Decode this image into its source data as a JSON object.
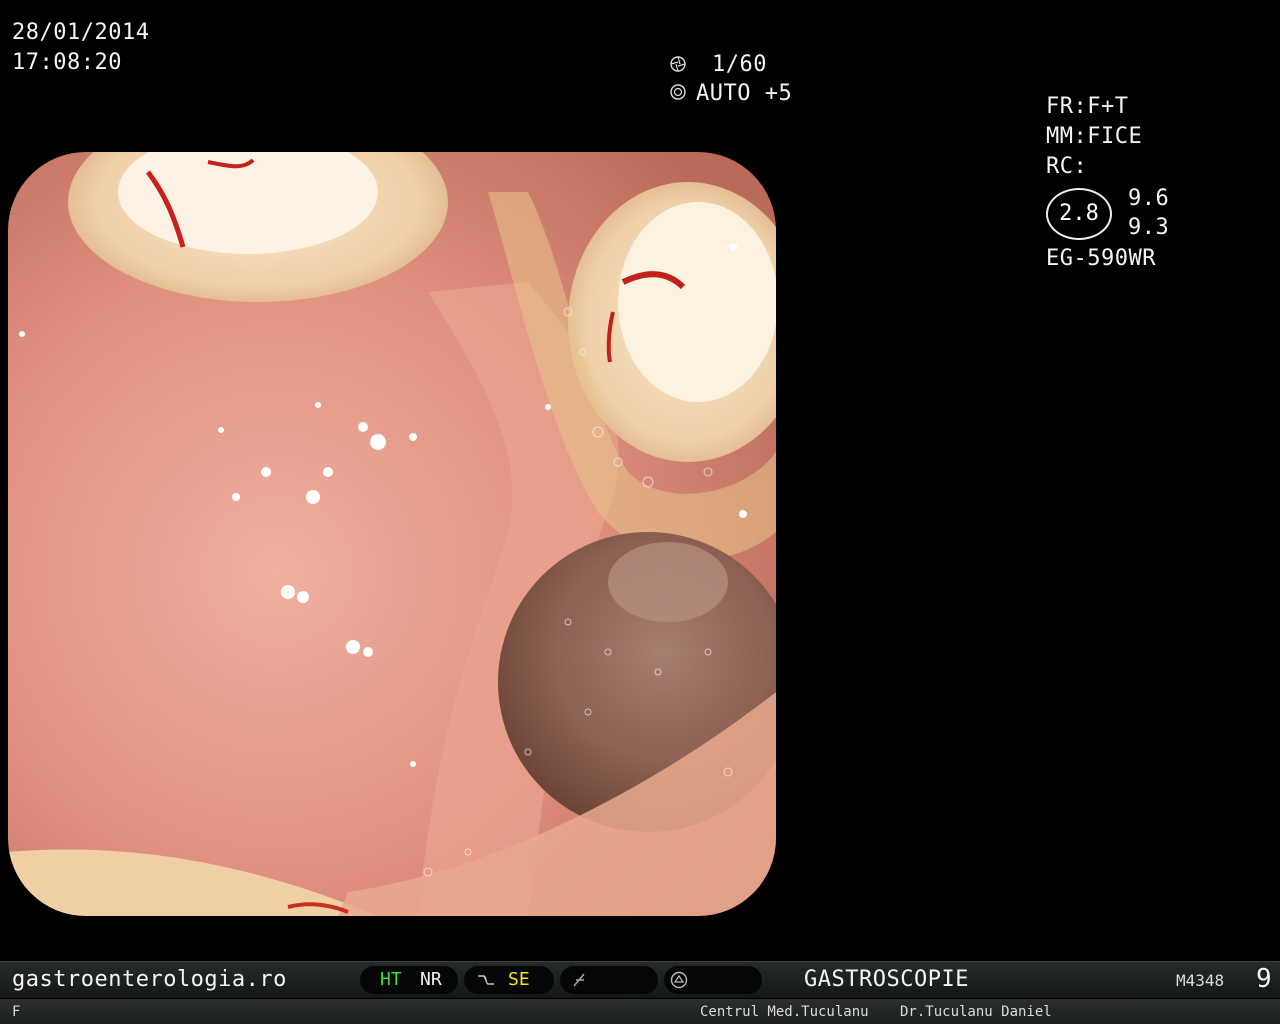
{
  "overlay": {
    "date": "28/01/2014",
    "time": "17:08:20",
    "shutter": "1/60",
    "exposure": "AUTO +5",
    "fr": "FR:F+T",
    "mm": "MM:FICE",
    "rc_label": "RC:",
    "rc_value": "2.8",
    "rc_top": "9.6",
    "rc_bottom": "9.3",
    "scope_model": "EG-590WR"
  },
  "icons": {
    "shutter": "aperture-icon",
    "exposure": "iris-icon",
    "se_mode": "wave-icon",
    "freeze": "slash-icon",
    "record": "record-icon"
  },
  "bottom_bar": {
    "website": "gastroenterologia.ro",
    "ht": "HT",
    "nr": "NR",
    "se": "SE",
    "procedure": "GASTROSCOPIE",
    "code": "M4348",
    "number": "9"
  },
  "footer": {
    "left": "F",
    "clinic": "Centrul Med.Tuculanu",
    "doctor": "Dr.Tuculanu Daniel"
  },
  "colors": {
    "ht": "#3cdc3c",
    "se": "#ffe020",
    "text": "#f4f4f4",
    "mucosa": "#e49a88"
  }
}
